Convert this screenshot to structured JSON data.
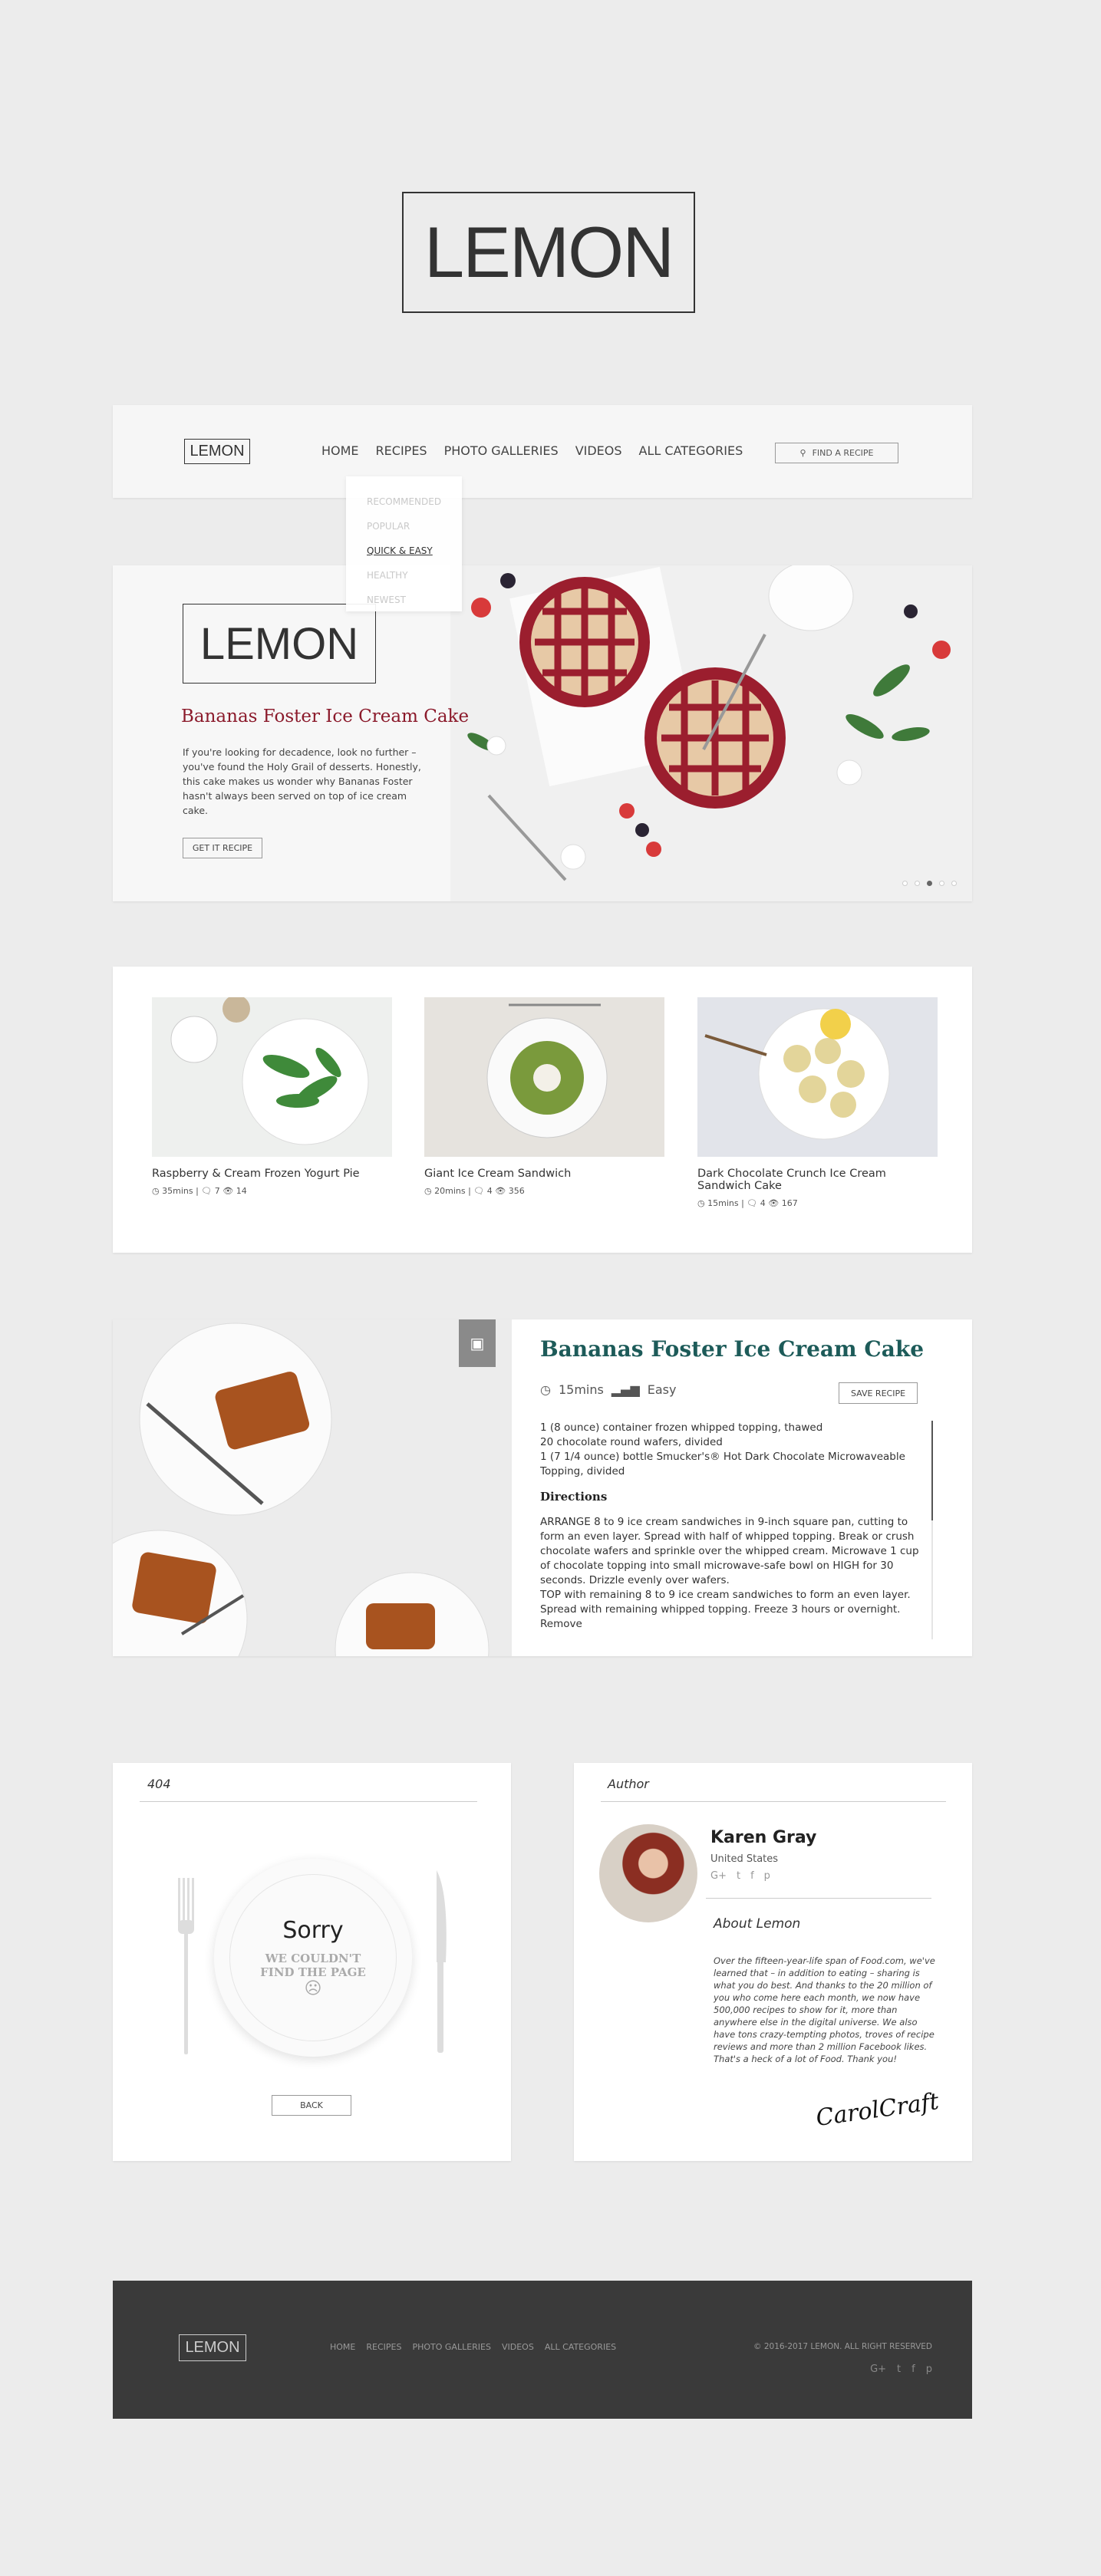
{
  "brand": {
    "logo_text": "LEMON"
  },
  "nav": {
    "logo_text": "LEMON",
    "links": [
      "HOME",
      "RECIPES",
      "PHOTO GALLERIES",
      "VIDEOS",
      "ALL CATEGORIES"
    ],
    "search_label": "FIND A RECIPE",
    "dropdown": [
      "RECOMMENDED",
      "POPULAR",
      "QUICK & EASY",
      "HEALTHY",
      "NEWEST"
    ],
    "dropdown_selected": "QUICK & EASY"
  },
  "hero": {
    "logo_text": "LEMON",
    "title": "Bananas Foster Ice Cream Cake",
    "text": "If you're looking for decadence, look no further – you've found the Holy Grail of desserts. Honestly, this cake makes us wonder why Bananas Foster hasn't always been served on top of ice cream cake.",
    "button": "GET IT RECIPE",
    "slide_count": 5,
    "active_slide": 3
  },
  "recipes": [
    {
      "title": "Raspberry & Cream Frozen Yogurt Pie",
      "time": "35mins",
      "comments": "7",
      "views": "14"
    },
    {
      "title": "Giant Ice Cream Sandwich",
      "time": "20mins",
      "comments": "4",
      "views": "356"
    },
    {
      "title": "Dark Chocolate Crunch Ice Cream Sandwich Cake",
      "time": "15mins",
      "comments": "4",
      "views": "167"
    }
  ],
  "detail": {
    "title": "Bananas Foster Ice Cream Cake",
    "time": "15mins",
    "difficulty": "Easy",
    "save_label": "SAVE RECIPE",
    "ingredients": [
      "1 (8 ounce) container frozen whipped topping, thawed",
      "20 chocolate round wafers, divided",
      "1 (7 1/4 ounce) bottle Smucker's® Hot Dark Chocolate Microwaveable Topping, divided"
    ],
    "directions_heading": "Directions",
    "directions": [
      "ARRANGE 8 to 9 ice cream sandwiches in 9-inch square pan, cutting to form an even layer. Spread with half of whipped topping. Break or crush chocolate wafers and sprinkle over the whipped cream. Microwave 1 cup of chocolate topping into small microwave-safe bowl on HIGH for 30 seconds. Drizzle evenly over wafers.",
      "TOP with remaining 8 to 9 ice cream sandwiches to form an even layer. Spread with remaining whipped topping. Freeze 3 hours or overnight. Remove"
    ]
  },
  "error_page": {
    "heading": "404",
    "sorry": "Sorry",
    "message": "WE COULDN'T FIND THE PAGE",
    "frown": "☹",
    "back_label": "BACK"
  },
  "author": {
    "heading": "Author",
    "name": "Karen Gray",
    "country": "United States",
    "social": [
      "G+",
      "t",
      "f",
      "p"
    ],
    "about_heading": "About Lemon",
    "about_text": "Over the fifteen-year-life span of Food.com, we've learned that – in addition to eating – sharing is what you do best. And thanks to the 20 million of you who come here each month, we now have 500,000 recipes to show for it, more than anywhere else in the digital universe. We also have tons crazy-tempting photos, troves of recipe reviews and more than 2 million Facebook likes. That's a heck of a lot of Food. Thank you!",
    "signature": "CarolCraft"
  },
  "footer": {
    "logo_text": "LEMON",
    "links": [
      "HOME",
      "RECIPES",
      "PHOTO GALLERIES",
      "VIDEOS",
      "ALL CATEGORIES"
    ],
    "copyright": "© 2016-2017 LEMON. ALL RIGHT RESERVED",
    "social": [
      "G+",
      "t",
      "f",
      "p"
    ]
  }
}
